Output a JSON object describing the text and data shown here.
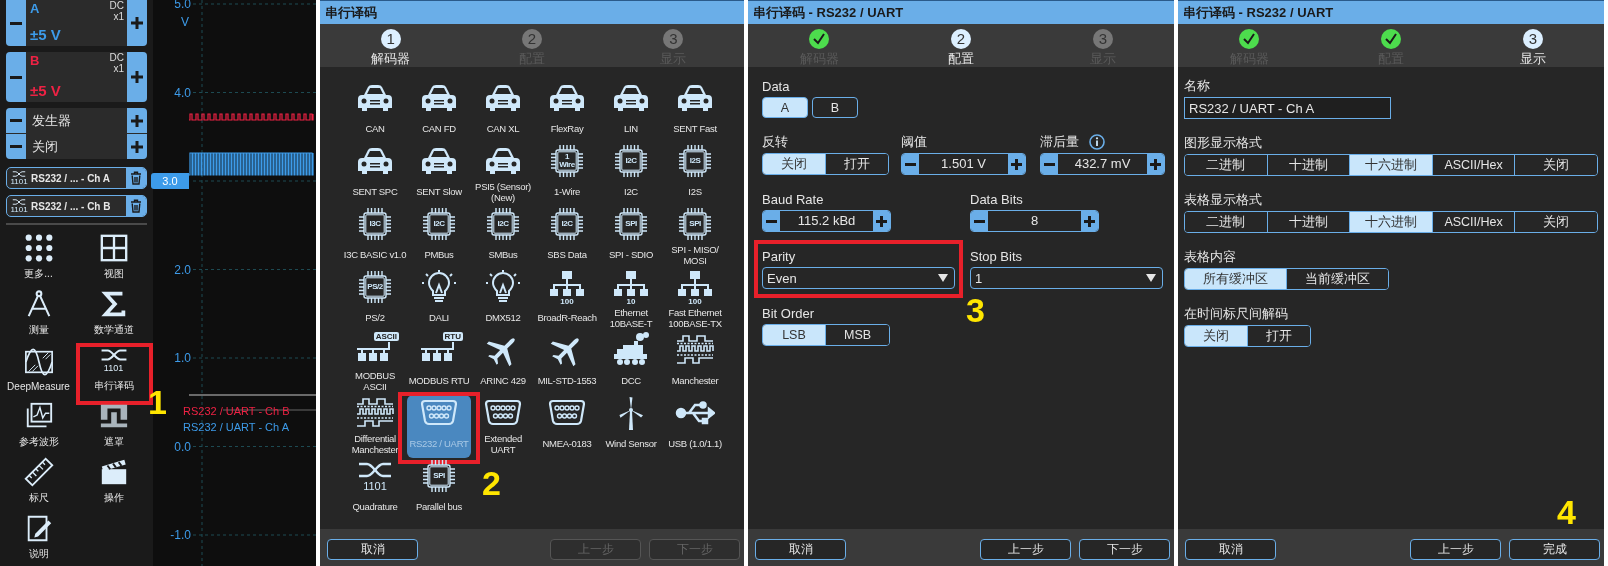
{
  "scope": {
    "channels": [
      {
        "name": "A",
        "coupling": "DC",
        "probe": "x1",
        "range": "±5 V",
        "color": "#3d9be9"
      },
      {
        "name": "B",
        "coupling": "DC",
        "probe": "x1",
        "range": "±5 V",
        "color": "#ee2244"
      }
    ],
    "generator": {
      "label": "发生器",
      "state": "关闭"
    },
    "decoders": [
      {
        "icon_text": "1101",
        "label": "RS232 / ... - Ch A"
      },
      {
        "icon_text": "1101",
        "label": "RS232 / ... - Ch B"
      }
    ],
    "tools": [
      {
        "label": "更多...",
        "kind": "dots"
      },
      {
        "label": "视图",
        "kind": "grid"
      },
      {
        "label": "测量",
        "kind": "compass"
      },
      {
        "label": "数学通道",
        "kind": "sigma"
      },
      {
        "label": "DeepMeasure",
        "kind": "deep-wave"
      },
      {
        "label": "串行译码",
        "kind": "quadrature",
        "icon_text": "1101",
        "callout": {
          "number": "1",
          "framed": true
        }
      },
      {
        "label": "参考波形",
        "kind": "ref-wave"
      },
      {
        "label": "遮罩",
        "kind": "mask"
      },
      {
        "label": "标尺",
        "kind": "ruler"
      },
      {
        "label": "操作",
        "kind": "clapper"
      },
      {
        "label": "说明",
        "kind": "note"
      }
    ],
    "graph": {
      "unit": "V",
      "ticks": [
        {
          "label": "5.0",
          "kind": "tick"
        },
        {
          "label": "4.0",
          "kind": "tick"
        },
        {
          "label": "3.0",
          "kind": "marker"
        },
        {
          "label": "2.0",
          "kind": "tick"
        },
        {
          "label": "1.0",
          "kind": "tick"
        },
        {
          "label": "0.0",
          "kind": "tick"
        },
        {
          "label": "-1.0",
          "kind": "tick"
        }
      ],
      "traces": [
        {
          "label": "RS232 / UART - Ch B",
          "color": "#ee2244"
        },
        {
          "label": "RS232 / UART - Ch A",
          "color": "#3d9be9"
        }
      ]
    }
  },
  "dialogs": [
    {
      "title": "串行译码",
      "steps": [
        {
          "number": "1",
          "label": "解码器",
          "kind": "current"
        },
        {
          "number": "2",
          "label": "配置",
          "kind": "pending"
        },
        {
          "number": "3",
          "label": "显示",
          "kind": "pending"
        }
      ],
      "content": {
        "kind": "decoder-grid",
        "items": [
          {
            "label": "CAN",
            "kind": "car",
            "selected": false
          },
          {
            "label": "CAN FD",
            "kind": "car",
            "selected": false
          },
          {
            "label": "CAN XL",
            "kind": "car",
            "selected": false
          },
          {
            "label": "FlexRay",
            "kind": "car",
            "selected": false
          },
          {
            "label": "LIN",
            "kind": "car",
            "selected": false
          },
          {
            "label": "SENT Fast",
            "kind": "car",
            "selected": false
          },
          {
            "label": "SENT SPC",
            "kind": "car",
            "selected": false
          },
          {
            "label": "SENT Slow",
            "kind": "car",
            "selected": false
          },
          {
            "label": "PSI5 (Sensor) (New)",
            "kind": "car",
            "selected": false
          },
          {
            "label": "1-Wire",
            "kind": "chip",
            "icon_text": "1 Wire",
            "selected": false
          },
          {
            "label": "I2C",
            "kind": "chip",
            "icon_text": "I2C",
            "selected": false
          },
          {
            "label": "I2S",
            "kind": "chip",
            "icon_text": "I2S",
            "selected": false
          },
          {
            "label": "I3C BASIC v1.0",
            "kind": "chip",
            "icon_text": "I3C",
            "selected": false
          },
          {
            "label": "PMBus",
            "kind": "chip",
            "icon_text": "I2C",
            "selected": false
          },
          {
            "label": "SMBus",
            "kind": "chip",
            "icon_text": "I2C",
            "selected": false
          },
          {
            "label": "SBS Data",
            "kind": "chip",
            "icon_text": "I2C",
            "selected": false
          },
          {
            "label": "SPI - SDIO",
            "kind": "chip",
            "icon_text": "SPI",
            "selected": false
          },
          {
            "label": "SPI - MISO/ MOSI",
            "kind": "chip",
            "icon_text": "SPI",
            "selected": false
          },
          {
            "label": "PS/2",
            "kind": "chip",
            "icon_text": "PS/2",
            "selected": false
          },
          {
            "label": "DALI",
            "kind": "bulb",
            "selected": false
          },
          {
            "label": "DMX512",
            "kind": "bulb",
            "selected": false
          },
          {
            "label": "BroadR-Reach",
            "kind": "network",
            "icon_text": "100",
            "selected": false
          },
          {
            "label": "Ethernet 10BASE-T",
            "kind": "network",
            "icon_text": "10",
            "selected": false
          },
          {
            "label": "Fast Ethernet 100BASE-TX",
            "kind": "network",
            "icon_text": "100",
            "selected": false
          },
          {
            "label": "MODBUS ASCII",
            "kind": "network-tag",
            "icon_text": "ASCII",
            "selected": false
          },
          {
            "label": "MODBUS RTU",
            "kind": "network-tag",
            "icon_text": "RTU",
            "selected": false
          },
          {
            "label": "ARINC 429",
            "kind": "plane",
            "selected": false
          },
          {
            "label": "MIL-STD-1553",
            "kind": "plane",
            "selected": false
          },
          {
            "label": "DCC",
            "kind": "train",
            "selected": false
          },
          {
            "label": "Manchester",
            "kind": "wave",
            "selected": false
          },
          {
            "label": "Differential Manchester",
            "kind": "wave",
            "selected": false
          },
          {
            "label": "RS232 / UART",
            "kind": "connector",
            "selected": true,
            "callout": {
              "number": "2",
              "framed": true
            }
          },
          {
            "label": "Extended UART",
            "kind": "connector",
            "selected": false
          },
          {
            "label": "NMEA-0183",
            "kind": "connector",
            "selected": false
          },
          {
            "label": "Wind Sensor",
            "kind": "turbine",
            "selected": false
          },
          {
            "label": "USB (1.0/1.1)",
            "kind": "usb",
            "selected": false
          },
          {
            "label": "Quadrature",
            "kind": "quadrature",
            "icon_text": "1101",
            "selected": false
          },
          {
            "label": "Parallel bus",
            "kind": "chip",
            "icon_text": "SPI",
            "selected": false
          }
        ]
      },
      "buttons": [
        {
          "label": "取消",
          "disabled": false
        },
        {
          "label": "上一步",
          "disabled": true
        },
        {
          "label": "下一步",
          "disabled": true
        }
      ]
    },
    {
      "title": "串行译码 - RS232 / UART",
      "steps": [
        {
          "label": "解码器",
          "kind": "done"
        },
        {
          "number": "2",
          "label": "配置",
          "kind": "current"
        },
        {
          "number": "3",
          "label": "显示",
          "kind": "pending"
        }
      ],
      "content": {
        "kind": "form",
        "rows": [
          [
            {
              "label": "Data",
              "kind": "toggle-buttons",
              "options": [
                {
                  "label": "A",
                  "selected": true
                },
                {
                  "label": "B",
                  "selected": false
                }
              ]
            }
          ],
          [
            {
              "label": "反转",
              "kind": "segmented",
              "options": [
                {
                  "label": "关闭",
                  "selected": true
                },
                {
                  "label": "打开",
                  "selected": false
                }
              ]
            },
            {
              "label": "阈值",
              "kind": "spinner",
              "value": "1.501 V"
            },
            {
              "label": "滞后量",
              "kind": "spinner",
              "value": "432.7 mV",
              "info": true
            }
          ],
          [
            {
              "label": "Baud Rate",
              "kind": "spinner",
              "value": "115.2 kBd"
            },
            {
              "label": "Data Bits",
              "kind": "spinner",
              "value": "8"
            }
          ],
          [
            {
              "label": "Parity",
              "kind": "select",
              "value": "Even",
              "callout": {
                "number": "3",
                "framed": true
              }
            },
            {
              "label": "Stop Bits",
              "kind": "select",
              "value": "1"
            }
          ],
          [
            {
              "label": "Bit Order",
              "kind": "segmented",
              "options": [
                {
                  "label": "LSB",
                  "selected": true
                },
                {
                  "label": "MSB",
                  "selected": false
                }
              ]
            }
          ]
        ]
      },
      "buttons": [
        {
          "label": "取消",
          "disabled": false
        },
        {
          "label": "上一步",
          "disabled": false
        },
        {
          "label": "下一步",
          "disabled": false
        }
      ]
    },
    {
      "title": "串行译码 - RS232 / UART",
      "steps": [
        {
          "label": "解码器",
          "kind": "done"
        },
        {
          "label": "配置",
          "kind": "done"
        },
        {
          "number": "3",
          "label": "显示",
          "kind": "current"
        }
      ],
      "content": {
        "kind": "form",
        "rows": [
          [
            {
              "label": "名称",
              "kind": "text",
              "value": "RS232 / UART - Ch A"
            }
          ],
          [
            {
              "label": "图形显示格式",
              "kind": "segmented",
              "options": [
                {
                  "label": "二进制",
                  "selected": false
                },
                {
                  "label": "十进制",
                  "selected": false
                },
                {
                  "label": "十六进制",
                  "selected": true
                },
                {
                  "label": "ASCII/Hex",
                  "selected": false
                },
                {
                  "label": "关闭",
                  "selected": false
                }
              ]
            }
          ],
          [
            {
              "label": "表格显示格式",
              "kind": "segmented",
              "options": [
                {
                  "label": "二进制",
                  "selected": false
                },
                {
                  "label": "十进制",
                  "selected": false
                },
                {
                  "label": "十六进制",
                  "selected": true
                },
                {
                  "label": "ASCII/Hex",
                  "selected": false
                },
                {
                  "label": "关闭",
                  "selected": false
                }
              ]
            }
          ],
          [
            {
              "label": "表格内容",
              "kind": "segmented",
              "options": [
                {
                  "label": "所有缓冲区",
                  "selected": true
                },
                {
                  "label": "当前缓冲区",
                  "selected": false
                }
              ]
            }
          ],
          [
            {
              "label": "在时间标尺间解码",
              "kind": "segmented",
              "options": [
                {
                  "label": "关闭",
                  "selected": true
                },
                {
                  "label": "打开",
                  "selected": false
                }
              ]
            }
          ]
        ]
      },
      "buttons": [
        {
          "label": "取消",
          "disabled": false
        },
        {
          "label": "上一步",
          "disabled": false
        },
        {
          "label": "完成",
          "disabled": false,
          "callout": {
            "number": "4",
            "framed": false
          }
        }
      ]
    }
  ]
}
